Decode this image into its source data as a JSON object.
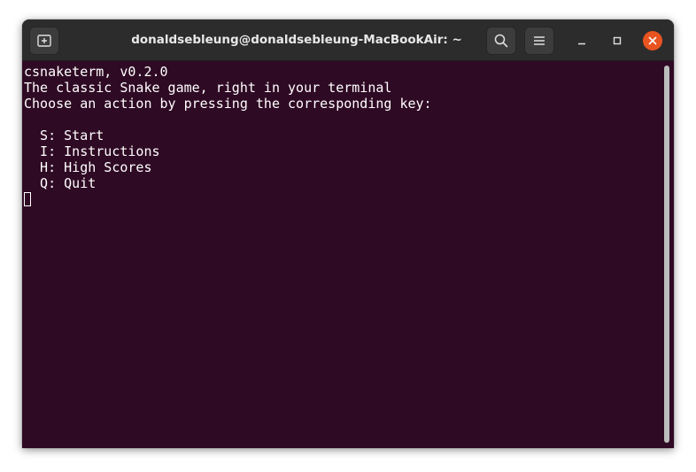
{
  "window": {
    "title": "donaldsebleung@donaldsebleung-MacBookAir: ~"
  },
  "titlebar": {
    "new_tab_icon": "new-tab-icon",
    "search_icon": "search-icon",
    "menu_icon": "hamburger-menu-icon",
    "minimize_icon": "minimize-icon",
    "maximize_icon": "maximize-icon",
    "close_icon": "close-icon"
  },
  "terminal": {
    "lines": [
      "csnaketerm, v0.2.0",
      "The classic Snake game, right in your terminal",
      "Choose an action by pressing the corresponding key:",
      "",
      "  S: Start",
      "  I: Instructions",
      "  H: High Scores",
      "  Q: Quit"
    ]
  },
  "colors": {
    "terminal_bg": "#2f0a24",
    "titlebar_bg": "#2c2c2c",
    "close_accent": "#e95420",
    "text": "#ffffff"
  }
}
